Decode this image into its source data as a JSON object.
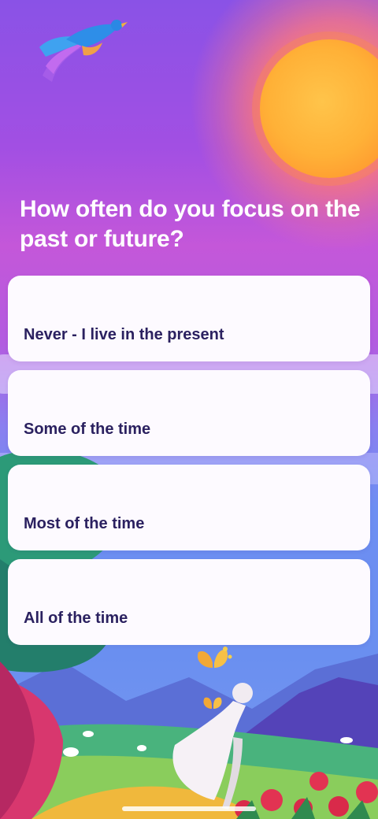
{
  "question": {
    "text": "How often do you focus on the past or future?"
  },
  "options": [
    {
      "label": "Never - I live in the present"
    },
    {
      "label": "Some of the time"
    },
    {
      "label": "Most of the time"
    },
    {
      "label": "All of the time"
    }
  ],
  "colors": {
    "option_background": "#fdfaff",
    "option_text": "#2b2160",
    "question_text": "#ffffff"
  },
  "illustration": {
    "icons": [
      "bird-illustration",
      "sun-illustration",
      "tree-illustration",
      "butterfly-illustration",
      "cloaked-figure-illustration",
      "flowers-illustration"
    ]
  }
}
